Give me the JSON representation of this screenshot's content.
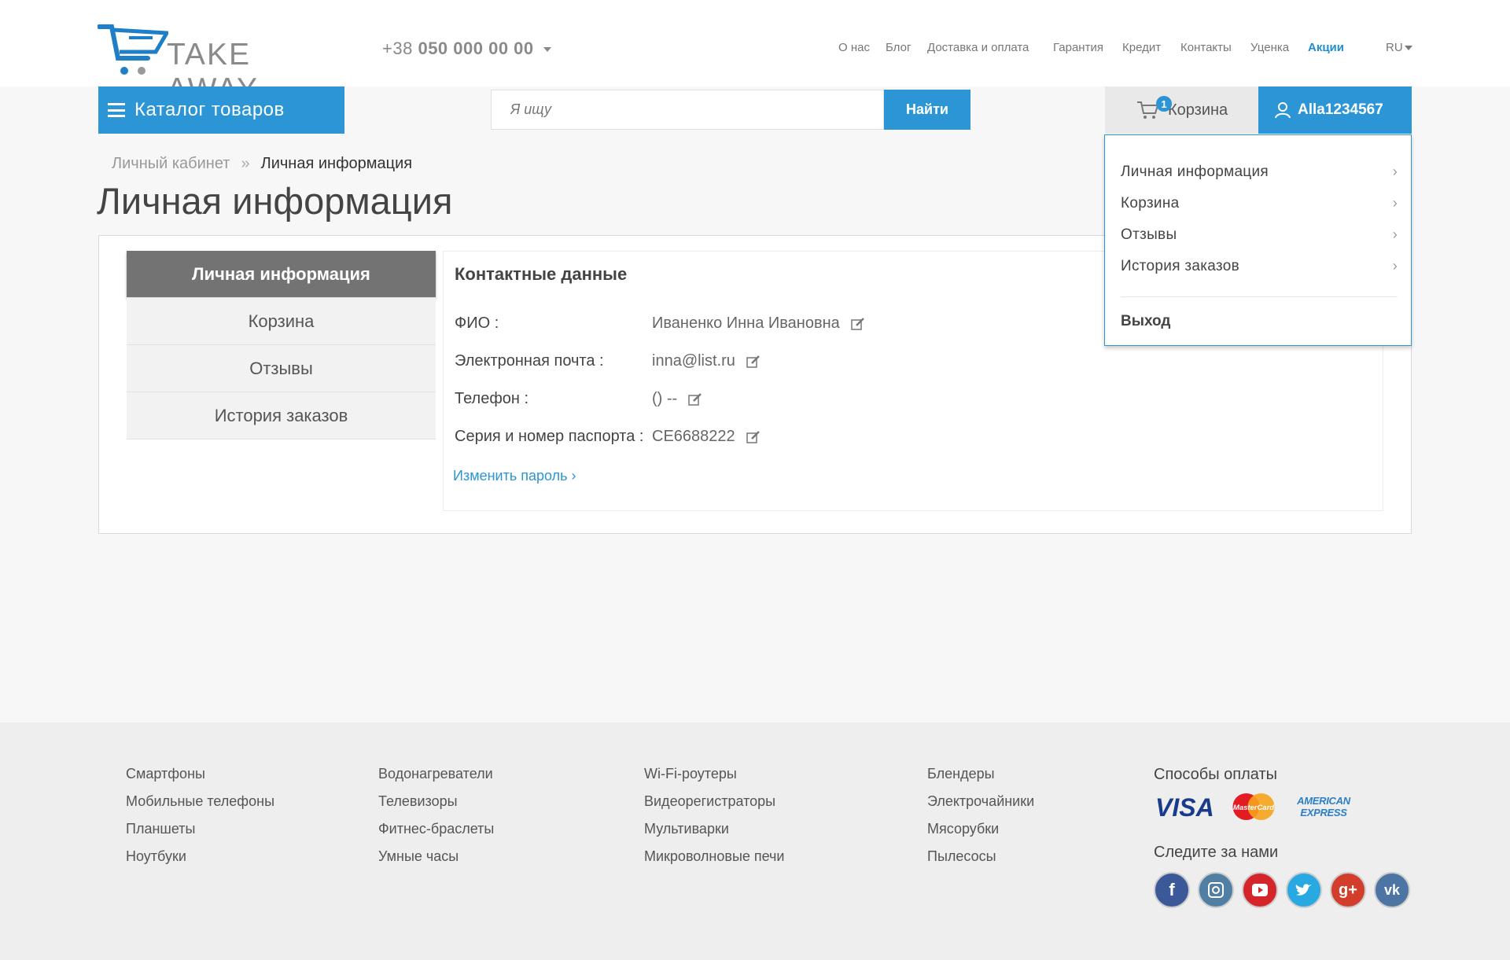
{
  "header": {
    "logo_text": "TAKE AWAY",
    "phone_prefix": "+38",
    "phone_number": "050 000 00 00",
    "nav": [
      "О нас",
      "Блог",
      "Доставка и оплата",
      "Гарантия",
      "Кредит",
      "Контакты",
      "Уценка",
      "Акции"
    ],
    "lang": "RU",
    "catalog_label": "Каталог товаров",
    "search_placeholder": "Я ищу",
    "search_button": "Найти",
    "cart_label": "Корзина",
    "cart_count": "1",
    "user_name": "Alla1234567"
  },
  "breadcrumb": [
    "Личный кабинет",
    "Личная информация"
  ],
  "page_title": "Личная информация",
  "sidebar": [
    "Личная информация",
    "Корзина",
    "Отзывы",
    "История заказов"
  ],
  "content": {
    "heading": "Контактные данные",
    "fields": [
      {
        "label": "ФИО :",
        "value": "Иваненко Инна Ивановна"
      },
      {
        "label": "Электронная почта :",
        "value": "inna@list.ru"
      },
      {
        "label": "Телефон :",
        "value": "() --"
      },
      {
        "label": "Серия и номер паспорта :",
        "value": "СЕ6688222"
      }
    ],
    "change_password": "Изменить пароль"
  },
  "user_menu": {
    "items": [
      "Личная информация",
      "Корзина",
      "Отзывы",
      "История заказов"
    ],
    "logout": "Выход"
  },
  "footer": {
    "col1": [
      "Смартфоны",
      "Мобильные телефоны",
      "Планшеты",
      "Ноутбуки"
    ],
    "col2": [
      "Водонагреватели",
      "Телевизоры",
      "Фитнес-браслеты",
      "Умные часы"
    ],
    "col3": [
      "Wi-Fi-роутеры",
      "Видеорегистраторы",
      "Мультиварки",
      "Микроволновые печи"
    ],
    "col4": [
      "Блендеры",
      "Электрочайники",
      "Мясорубки",
      "Пылесосы"
    ],
    "payment_heading": "Способы оплаты",
    "social_heading": "Следите за нами",
    "payment_methods": [
      "VISA",
      "MasterCard",
      "AMERICAN EXPRESS"
    ],
    "social": [
      "facebook",
      "instagram",
      "youtube",
      "twitter",
      "google-plus",
      "vk"
    ]
  },
  "colors": {
    "accent": "#2b95d6",
    "sidebar_active": "#737373"
  }
}
